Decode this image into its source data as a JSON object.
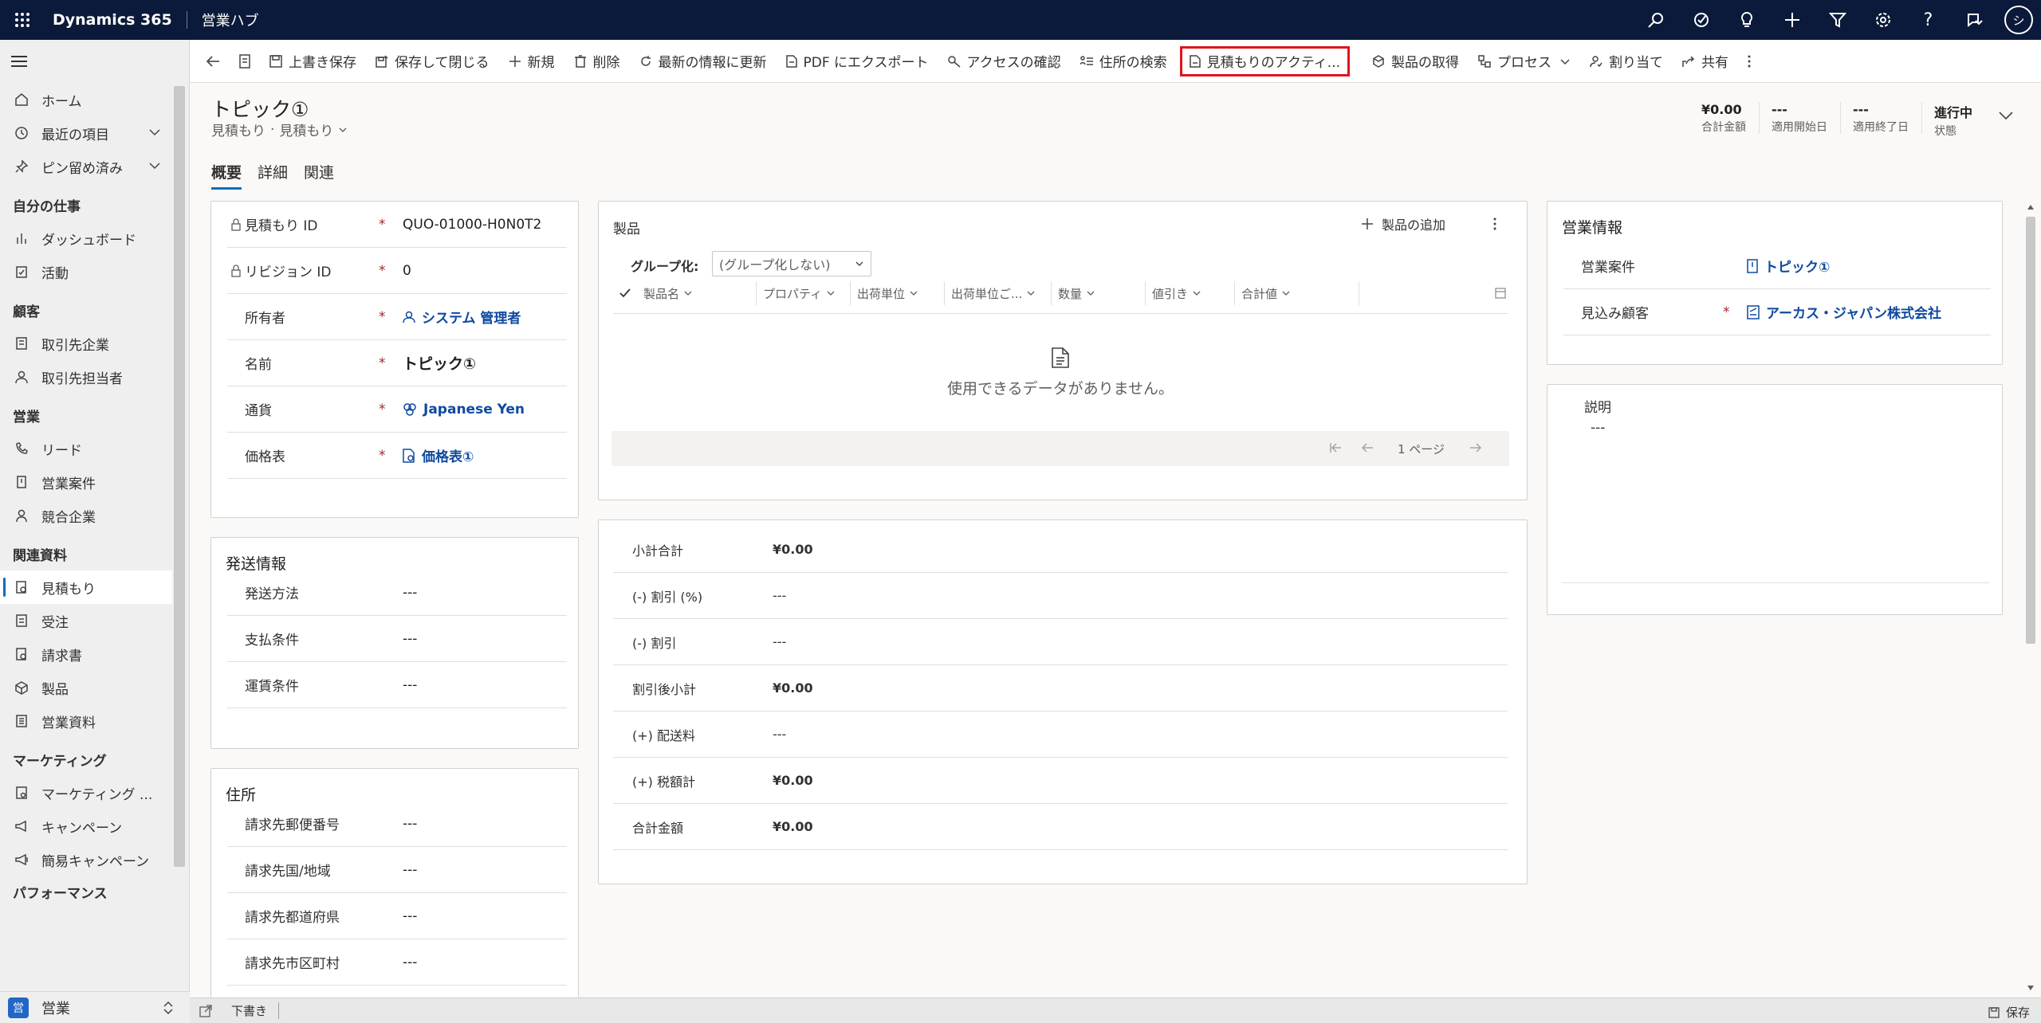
{
  "topbar": {
    "brand": "Dynamics 365",
    "hub": "営業ハブ",
    "avatar_initial": "シ",
    "icons": [
      "search-icon",
      "task-icon",
      "lightbulb-icon",
      "plus-icon",
      "filter-icon",
      "gear-icon",
      "help-icon",
      "assist-icon"
    ]
  },
  "sidebar": {
    "top_items": [
      {
        "label": "ホーム",
        "icon": "home-icon"
      },
      {
        "label": "最近の項目",
        "icon": "clock-icon"
      },
      {
        "label": "ピン留め済み",
        "icon": "pin-icon"
      }
    ],
    "sections": [
      {
        "title": "自分の仕事",
        "items": [
          "ダッシュボード",
          "活動"
        ]
      },
      {
        "title": "顧客",
        "items": [
          "取引先企業",
          "取引先担当者"
        ]
      },
      {
        "title": "営業",
        "items": [
          "リード",
          "営業案件",
          "競合企業"
        ]
      },
      {
        "title": "関連資料",
        "items": [
          "見積もり",
          "受注",
          "請求書",
          "製品",
          "営業資料"
        ]
      },
      {
        "title": "マーケティング",
        "items": [
          "マーケティング ...",
          "キャンペーン",
          "簡易キャンペーン"
        ]
      },
      {
        "title": "パフォーマンス",
        "items": []
      }
    ],
    "area_badge": "営",
    "area_label": "営業"
  },
  "commands": [
    {
      "label": "上書き保存",
      "icon": "save-icon"
    },
    {
      "label": "保存して閉じる",
      "icon": "save-close-icon"
    },
    {
      "label": "新規",
      "icon": "plus-icon"
    },
    {
      "label": "削除",
      "icon": "trash-icon"
    },
    {
      "label": "最新の情報に更新",
      "icon": "refresh-icon"
    },
    {
      "label": "PDF にエクスポート",
      "icon": "pdf-icon"
    },
    {
      "label": "アクセスの確認",
      "icon": "key-icon"
    },
    {
      "label": "住所の検索",
      "icon": "address-icon"
    },
    {
      "label": "見積もりのアクティ...",
      "icon": "document-icon"
    },
    {
      "label": "製品の取得",
      "icon": "box-icon"
    },
    {
      "label": "プロセス",
      "icon": "process-icon"
    },
    {
      "label": "割り当て",
      "icon": "person-icon"
    },
    {
      "label": "共有",
      "icon": "share-icon"
    }
  ],
  "header": {
    "title": "トピック①",
    "entity": "見積もり",
    "form": "見積もり",
    "fields": [
      {
        "value": "¥0.00",
        "label": "合計金額"
      },
      {
        "value": "---",
        "label": "適用開始日"
      },
      {
        "value": "---",
        "label": "適用終了日"
      },
      {
        "value": "進行中",
        "label": "状態"
      }
    ]
  },
  "tabs": [
    "概要",
    "詳細",
    "関連"
  ],
  "summary": {
    "rows": [
      {
        "label": "見積もり ID",
        "value": "QUO-01000-H0N0T2",
        "locked": true,
        "required": true
      },
      {
        "label": "リビジョン ID",
        "value": "0",
        "locked": true,
        "required": true
      },
      {
        "label": "所有者",
        "value": "システム 管理者",
        "required": true,
        "link": true,
        "icon": "user-icon"
      },
      {
        "label": "名前",
        "value": "トピック①",
        "required": true
      },
      {
        "label": "通貨",
        "value": "Japanese Yen",
        "required": true,
        "link": true,
        "icon": "currency-icon"
      },
      {
        "label": "価格表",
        "value": "価格表①",
        "required": true,
        "link": true,
        "icon": "pricelist-icon"
      }
    ]
  },
  "shipping": {
    "title": "発送情報",
    "rows": [
      {
        "label": "発送方法",
        "value": "---"
      },
      {
        "label": "支払条件",
        "value": "---"
      },
      {
        "label": "運賃条件",
        "value": "---"
      }
    ]
  },
  "address": {
    "title": "住所",
    "rows": [
      {
        "label": "請求先郵便番号",
        "value": "---"
      },
      {
        "label": "請求先国/地域",
        "value": "---"
      },
      {
        "label": "請求先都道府県",
        "value": "---"
      },
      {
        "label": "請求先市区町村",
        "value": "---"
      }
    ]
  },
  "products": {
    "title": "製品",
    "add_label": "製品の追加",
    "group_by_label": "グループ化:",
    "group_by_value": "(グループ化しない)",
    "columns": [
      "製品名",
      "プロパティ",
      "出荷単位",
      "出荷単位ご...",
      "数量",
      "値引き",
      "合計値"
    ],
    "empty_message": "使用できるデータがありません。",
    "page_label": "1 ページ"
  },
  "totals": [
    {
      "label": "小計合計",
      "value": "¥0.00",
      "bold": true
    },
    {
      "label": "(-) 割引 (%)",
      "value": "---"
    },
    {
      "label": "(-) 割引",
      "value": "---"
    },
    {
      "label": "割引後小計",
      "value": "¥0.00",
      "bold": true
    },
    {
      "label": "(+) 配送料",
      "value": "---"
    },
    {
      "label": "(+) 税額計",
      "value": "¥0.00",
      "bold": true
    },
    {
      "label": "合計金額",
      "value": "¥0.00",
      "bold": true
    }
  ],
  "sales_info": {
    "title": "営業情報",
    "rows": [
      {
        "label": "営業案件",
        "value": "トピック①",
        "required": false
      },
      {
        "label": "見込み顧客",
        "value": "アーカス・ジャパン株式会社",
        "required": true
      }
    ]
  },
  "description": {
    "label": "説明",
    "value": "---"
  },
  "footer": {
    "status": "下書き",
    "save_label": "保存"
  }
}
